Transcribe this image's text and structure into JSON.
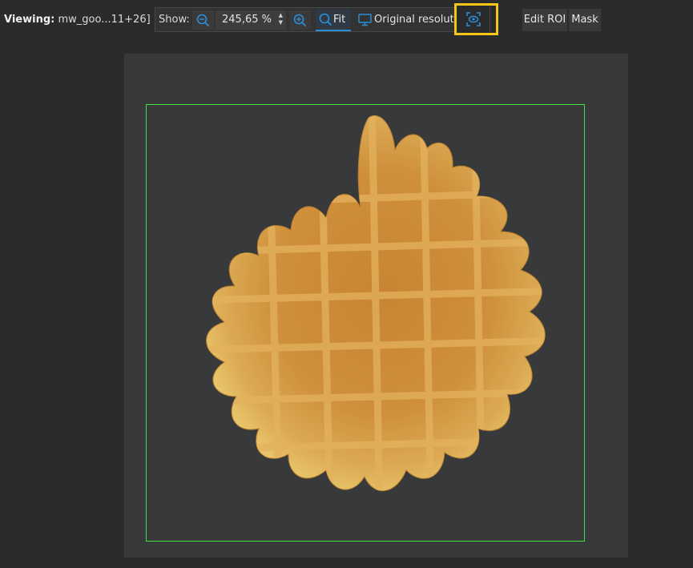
{
  "header": {
    "viewing_label": "Viewing:",
    "file_name": "mw_goo...11+26]"
  },
  "show": {
    "label": "Show:",
    "zoom_value": "245,65 %",
    "fit_label": "Fit",
    "original_resolution_label": "Original resolution"
  },
  "actions": {
    "edit_roi_label": "Edit ROI",
    "mask_label": "Mask"
  },
  "icons": {
    "zoom_out": "zoom-out-icon",
    "zoom_in": "zoom-in-icon",
    "fit": "fit-icon",
    "original_resolution": "monitor-icon",
    "roi_view": "roi-view-icon"
  },
  "colors": {
    "background": "#2b2b2b",
    "accent": "#2b8fd6",
    "highlight": "#f5c518",
    "roi": "#3fe03f"
  }
}
